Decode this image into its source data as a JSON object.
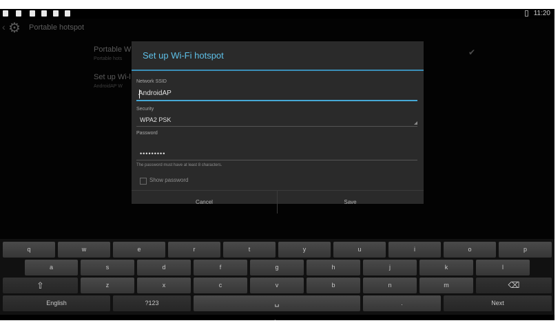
{
  "status_bar": {
    "time": "11:20"
  },
  "action_bar": {
    "title": "Portable hotspot"
  },
  "background": {
    "item1_title": "Portable W",
    "item1_sub": "Portable hots",
    "item2_title": "Set up Wi-l",
    "item2_sub": "AndroidAP W"
  },
  "dialog": {
    "title": "Set up Wi-Fi hotspot",
    "ssid_label": "Network SSID",
    "ssid_value": "AndroidAP",
    "security_label": "Security",
    "security_value": "WPA2 PSK",
    "password_label": "Password",
    "password_value": "•••••••••",
    "password_hint": "The password must have at least 8 characters.",
    "show_password_label": "Show password",
    "show_password_checked": false,
    "cancel_label": "Cancel",
    "save_label": "Save",
    "accent_color": "#5ec0e8"
  },
  "keyboard": {
    "row1": [
      "q",
      "w",
      "e",
      "r",
      "t",
      "y",
      "u",
      "i",
      "o",
      "p"
    ],
    "row2": [
      "a",
      "s",
      "d",
      "f",
      "g",
      "h",
      "j",
      "k",
      "l"
    ],
    "shift": "⇧",
    "row3": [
      "z",
      "x",
      "c",
      "v",
      "b",
      "n",
      "m"
    ],
    "delete": "⌫",
    "language": "English",
    "symbols": "?123",
    "space": "␣",
    "period": ".",
    "next": "Next"
  },
  "nav_bar": {
    "back": "⌄",
    "home": "⌂",
    "recents": "▭"
  }
}
